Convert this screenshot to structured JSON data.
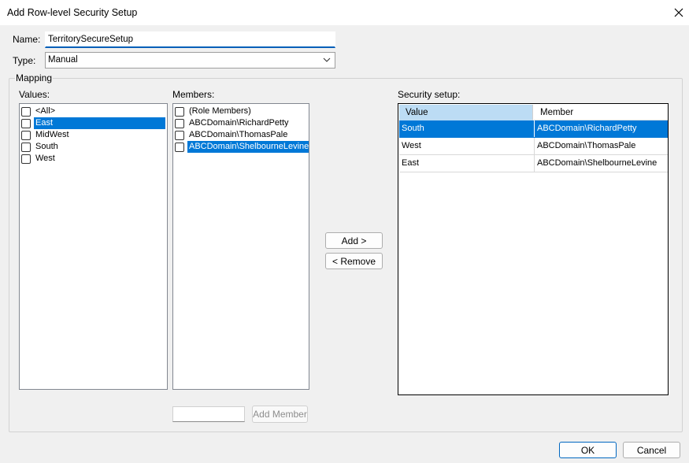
{
  "window": {
    "title": "Add Row-level Security Setup"
  },
  "name_field": {
    "label": "Name:",
    "value": "TerritorySecureSetup"
  },
  "type_field": {
    "label": "Type:",
    "value": "Manual"
  },
  "mapping": {
    "legend": "Mapping",
    "values": {
      "label": "Values:",
      "items": [
        {
          "label": "<All>",
          "checked": false,
          "selected": false
        },
        {
          "label": "East",
          "checked": false,
          "selected": true
        },
        {
          "label": "MidWest",
          "checked": false,
          "selected": false
        },
        {
          "label": "South",
          "checked": false,
          "selected": false
        },
        {
          "label": "West",
          "checked": false,
          "selected": false
        }
      ]
    },
    "members": {
      "label": "Members:",
      "items": [
        {
          "label": "(Role Members)",
          "checked": false,
          "selected": false
        },
        {
          "label": "ABCDomain\\RichardPetty",
          "checked": false,
          "selected": false
        },
        {
          "label": "ABCDomain\\ThomasPale",
          "checked": false,
          "selected": false
        },
        {
          "label": "ABCDomain\\ShelbourneLevine",
          "checked": false,
          "selected": true
        }
      ],
      "new_member_value": "",
      "add_member_label": "Add Member"
    },
    "add_label": "Add >",
    "remove_label": "< Remove",
    "security": {
      "label": "Security setup:",
      "columns": [
        "Value",
        "Member"
      ],
      "rows": [
        {
          "value": "South",
          "member": "ABCDomain\\RichardPetty",
          "selected": true
        },
        {
          "value": "West",
          "member": "ABCDomain\\ThomasPale",
          "selected": false
        },
        {
          "value": "East",
          "member": "ABCDomain\\ShelbourneLevine",
          "selected": false
        }
      ]
    }
  },
  "footer": {
    "ok_label": "OK",
    "cancel_label": "Cancel"
  },
  "icons": {
    "close": "close-icon",
    "dropdown": "chevron-down-icon"
  },
  "colors": {
    "selection": "#0078d7",
    "focus_underline": "#005fb8",
    "header_highlight": "#bcdcf4"
  }
}
